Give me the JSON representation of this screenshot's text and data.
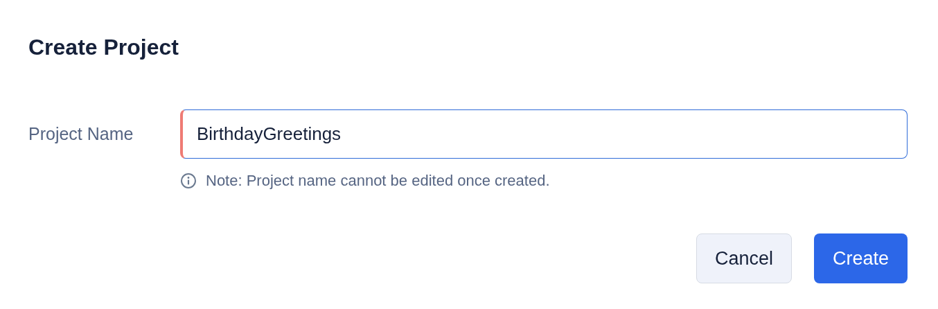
{
  "dialog": {
    "title": "Create Project"
  },
  "field": {
    "label": "Project Name",
    "value": "BirthdayGreetings",
    "required": true,
    "focused": true
  },
  "note": "Note: Project name cannot be edited once created.",
  "buttons": [
    {
      "label": "Cancel",
      "kind": "secondary"
    },
    {
      "label": "Create",
      "kind": "primary"
    }
  ]
}
